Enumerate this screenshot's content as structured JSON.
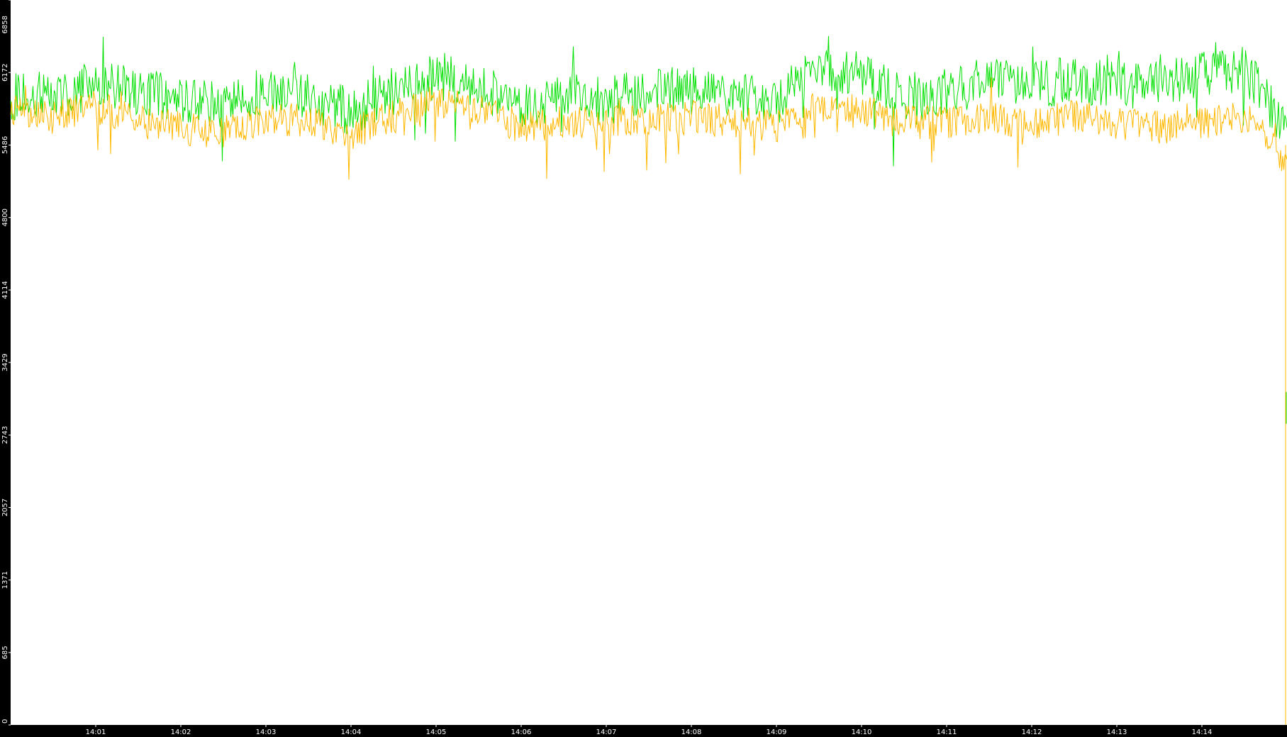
{
  "chart_data": {
    "type": "line",
    "title": "",
    "xlabel": "",
    "ylabel": "",
    "ylim": [
      0,
      6858
    ],
    "y_ticks": [
      "0",
      "685",
      "1371",
      "2057",
      "2743",
      "3429",
      "4114",
      "4800",
      "5486",
      "6172",
      "6858"
    ],
    "x_ticks": [
      "14:01",
      "14:02",
      "14:03",
      "14:04",
      "14:05",
      "14:06",
      "14:07",
      "14:08",
      "14:09",
      "14:10",
      "14:11",
      "14:12",
      "14:13",
      "14:14"
    ],
    "x_range": [
      "14:00:00",
      "14:15:00"
    ],
    "grid": false,
    "legend": "none",
    "background_color": "#ffffff",
    "frame_color": "#000000",
    "series": [
      {
        "color": "#00e000",
        "x": [
          "14:00",
          "14:00:30",
          "14:01",
          "14:01:30",
          "14:02",
          "14:02:30",
          "14:03",
          "14:03:30",
          "14:04",
          "14:04:30",
          "14:05",
          "14:05:30",
          "14:06",
          "14:06:30",
          "14:07",
          "14:07:30",
          "14:08",
          "14:08:30",
          "14:09",
          "14:09:30",
          "14:10",
          "14:10:30",
          "14:11",
          "14:11:30",
          "14:12",
          "14:12:30",
          "14:13",
          "14:13:30",
          "14:14",
          "14:14:30",
          "14:15"
        ],
        "values": [
          5950,
          5950,
          6050,
          6000,
          5900,
          5850,
          6000,
          5950,
          5800,
          6000,
          6150,
          6050,
          5850,
          5950,
          5900,
          6000,
          6000,
          5950,
          5900,
          6250,
          6150,
          5950,
          6000,
          6100,
          6050,
          6100,
          6050,
          6050,
          6150,
          6200,
          5650
        ]
      },
      {
        "color": "#ffb800",
        "x": [
          "14:00",
          "14:00:30",
          "14:01",
          "14:01:30",
          "14:02",
          "14:02:30",
          "14:03",
          "14:03:30",
          "14:04",
          "14:04:30",
          "14:05",
          "14:05:30",
          "14:06",
          "14:06:30",
          "14:07",
          "14:07:30",
          "14:08",
          "14:08:30",
          "14:09",
          "14:09:30",
          "14:10",
          "14:10:30",
          "14:11",
          "14:11:30",
          "14:12",
          "14:12:30",
          "14:13",
          "14:13:30",
          "14:14",
          "14:14:30",
          "14:15"
        ],
        "values": [
          5800,
          5750,
          5850,
          5700,
          5650,
          5600,
          5750,
          5700,
          5600,
          5750,
          5900,
          5850,
          5650,
          5700,
          5700,
          5700,
          5750,
          5700,
          5650,
          5850,
          5800,
          5700,
          5700,
          5750,
          5700,
          5750,
          5700,
          5650,
          5700,
          5750,
          5350
        ]
      }
    ],
    "annotations": []
  }
}
